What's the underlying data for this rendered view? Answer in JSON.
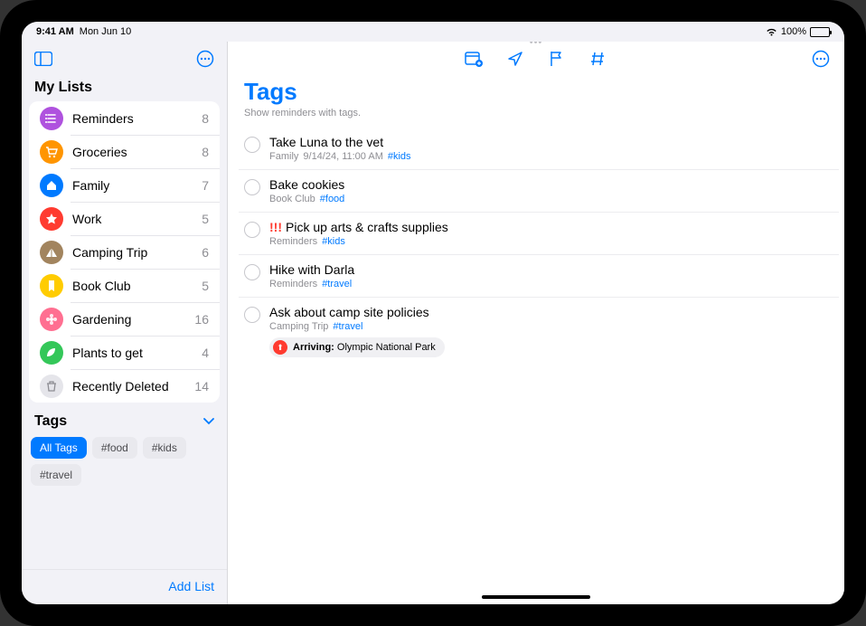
{
  "status": {
    "time": "9:41 AM",
    "date": "Mon Jun 10",
    "battery": "100%"
  },
  "sidebar": {
    "header": "My Lists",
    "lists": [
      {
        "name": "Reminders",
        "count": "8",
        "color": "#af52de",
        "glyph": "list"
      },
      {
        "name": "Groceries",
        "count": "8",
        "color": "#ff9500",
        "glyph": "cart"
      },
      {
        "name": "Family",
        "count": "7",
        "color": "#007aff",
        "glyph": "house"
      },
      {
        "name": "Work",
        "count": "5",
        "color": "#ff3b30",
        "glyph": "star"
      },
      {
        "name": "Camping Trip",
        "count": "6",
        "color": "#a2845e",
        "glyph": "tent"
      },
      {
        "name": "Book Club",
        "count": "5",
        "color": "#ffcc00",
        "glyph": "bookmark"
      },
      {
        "name": "Gardening",
        "count": "16",
        "color": "#ff6f91",
        "glyph": "flower"
      },
      {
        "name": "Plants to get",
        "count": "4",
        "color": "#34c759",
        "glyph": "leaf"
      },
      {
        "name": "Recently Deleted",
        "count": "14",
        "color": "#d1d1d6",
        "glyph": "trash"
      }
    ],
    "tagsHeader": "Tags",
    "tags": [
      {
        "label": "All Tags",
        "active": true
      },
      {
        "label": "#food"
      },
      {
        "label": "#kids"
      },
      {
        "label": "#travel"
      }
    ],
    "addList": "Add List"
  },
  "main": {
    "title": "Tags",
    "subtitle": "Show reminders with tags.",
    "reminders": [
      {
        "title": "Take Luna to the vet",
        "list": "Family",
        "extra": "9/14/24, 11:00 AM",
        "tag": "#kids"
      },
      {
        "title": "Bake cookies",
        "list": "Book Club",
        "tag": "#food"
      },
      {
        "title": "Pick up arts & crafts supplies",
        "priority": "!!!",
        "list": "Reminders",
        "tag": "#kids"
      },
      {
        "title": "Hike with Darla",
        "list": "Reminders",
        "tag": "#travel"
      },
      {
        "title": "Ask about camp site policies",
        "list": "Camping Trip",
        "tag": "#travel",
        "locationLabel": "Arriving:",
        "location": "Olympic National Park"
      }
    ]
  }
}
